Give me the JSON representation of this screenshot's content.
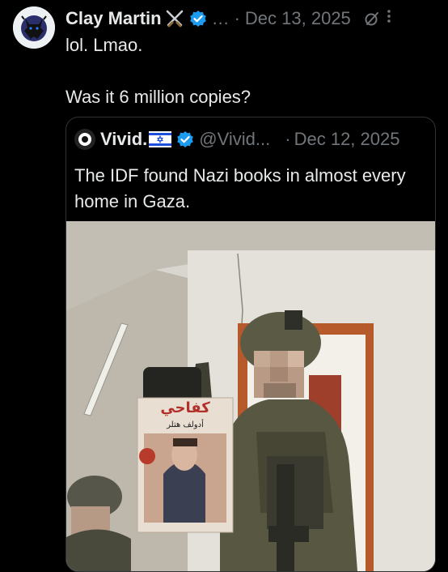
{
  "author": {
    "name": "Clay Martin",
    "name_emoji_icon": "crossed-swords-icon",
    "separator": "…",
    "dot": "·",
    "date": "Dec 13, 2025",
    "more_icon": "more-icon"
  },
  "post": {
    "line1": "lol. Lmao.",
    "line2": "Was it 6 million copies?"
  },
  "quoted": {
    "name": "Vivid.",
    "flag_icon": "israel-flag-icon",
    "handle": "@Vivid...",
    "dot": "·",
    "date": "Dec 12, 2025",
    "text": "The IDF found Nazi books in almost every home in Gaza.",
    "book_title": "كفاحي",
    "book_author": "أدولف هتلر"
  },
  "colors": {
    "background": "#000000",
    "text": "#e7e9ea",
    "muted": "#71767b",
    "verified": "#1d9bf0",
    "border": "#2f3336"
  }
}
